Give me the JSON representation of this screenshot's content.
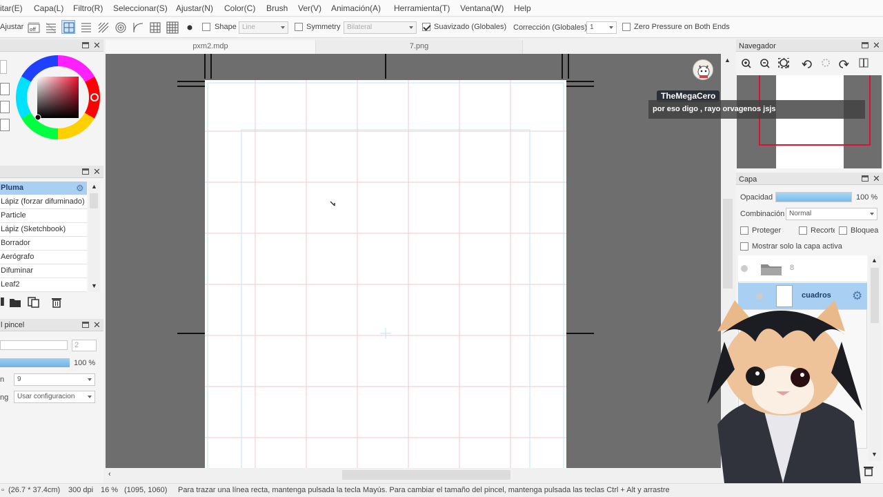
{
  "menu": [
    "itar(E)",
    "Capa(L)",
    "Filtro(R)",
    "Seleccionar(S)",
    "Ajustar(N)",
    "Color(C)",
    "Brush",
    "Ver(V)",
    "Animación(A)",
    "Herramienta(T)",
    "Ventana(W)",
    "Help"
  ],
  "toolbar": {
    "adjust_label": "Ajustar",
    "off_label": "off",
    "shape_label": "Shape",
    "shape_value": "Line",
    "symmetry_label": "Symmetry",
    "symmetry_value": "Bilateral",
    "smooth_label": "Suavizado (Globales)",
    "correction_label": "Corrección (Globales)",
    "correction_value": "1",
    "zero_pressure_label": "Zero Pressure on Both Ends",
    "shape_checked": false,
    "symmetry_checked": false,
    "smooth_checked": true,
    "zero_pressure_checked": false
  },
  "tabs": [
    "pxm2.mdp",
    "7.png"
  ],
  "brush_panel": {
    "category": "Pluma",
    "items": [
      "Lápiz (forzar difuminado)",
      "Particle",
      "Lápiz (Sketchbook)",
      "Borrador",
      "Aerógrafo",
      "Difuminar",
      "Leaf2"
    ]
  },
  "brush_settings": {
    "title": "l pincel",
    "size_value": "2",
    "opacity_value": "100 %",
    "opacity_fraction": 1.0,
    "h_label": "n",
    "h_value": "9",
    "g_label": "ng",
    "g_value": "Usar configuracion"
  },
  "navigator": {
    "title": "Navegador"
  },
  "layer_panel": {
    "title": "Capa",
    "opacity_label": "Opacidad",
    "opacity_value": "100 %",
    "opacity_fraction": 1.0,
    "blend_label": "Combinación",
    "blend_value": "Normal",
    "protect_alpha": "Proteger alf",
    "clip": "Recorte",
    "lock": "Bloquea",
    "show_active_only": "Mostrar solo la capa activa",
    "folder_name": "8",
    "layer_name": "cuadros"
  },
  "chat": {
    "user": "TheMegaCero",
    "message": "por eso digo , rayo orvagenos jsjs"
  },
  "status": {
    "size": "(26.7 * 37.4cm)",
    "dpi": "300 dpi",
    "zoom": "16 %",
    "coords": "(1095, 1060)",
    "hint": "Para trazar una línea recta, mantenga pulsada la tecla Mayús. Para cambiar el tamaño del pincel, mantenga pulsada las teclas Ctrl + Alt y arrastre"
  },
  "colors": {
    "accent": "#7fb8e8",
    "selected_row": "#a9d0f2",
    "canvas_bg": "#6e6e6e",
    "grid_red": "#f2c8cc",
    "grid_cyan": "#bfe6ec"
  }
}
